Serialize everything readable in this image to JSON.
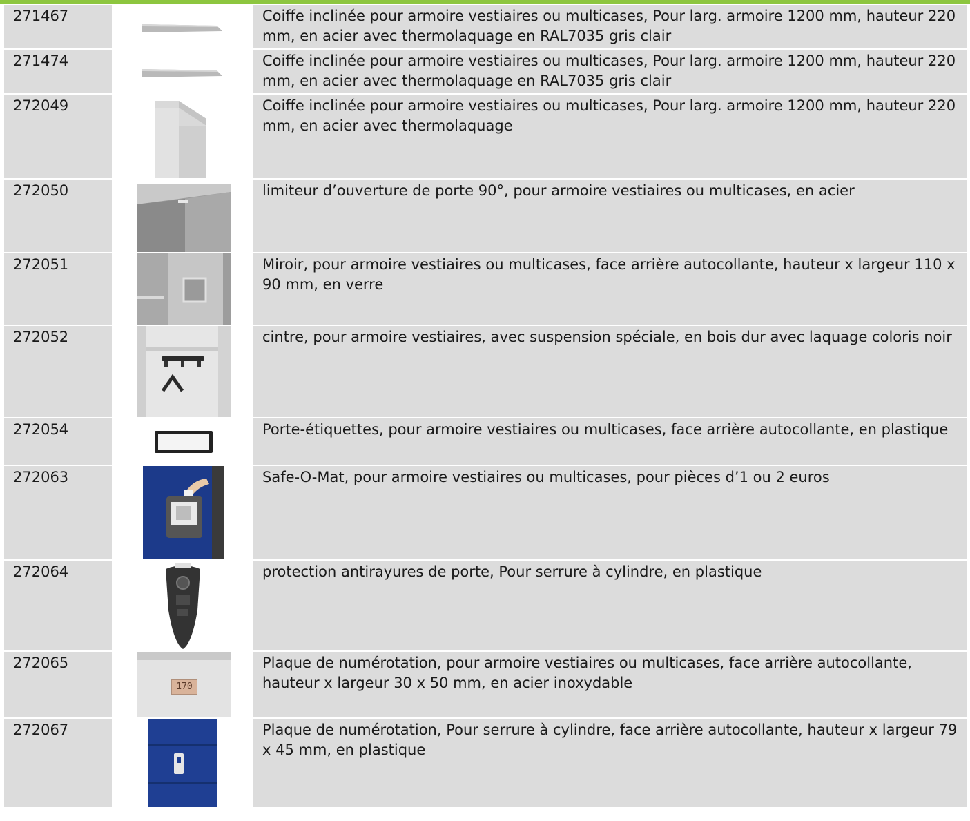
{
  "colors": {
    "accent_bar": "#8dc63f",
    "row_bg": "#dcdcdc"
  },
  "rows": [
    {
      "code": "271467",
      "image_icon": "sloped-cover-icon",
      "description": "Coiffe inclinée pour armoire vestiaires ou multicases, Pour larg. armoire 1200 mm, hauteur 220 mm, en acier avec thermolaquage en RAL7035 gris clair"
    },
    {
      "code": "271474",
      "image_icon": "sloped-cover-icon",
      "description": "Coiffe inclinée pour armoire vestiaires ou multicases, Pour larg. armoire 1200 mm, hauteur 220 mm, en acier avec thermolaquage en RAL7035 gris clair"
    },
    {
      "code": "272049",
      "image_icon": "locker-roof-icon",
      "description": "Coiffe inclinée pour armoire vestiaires ou multicases, Pour larg. armoire 1200 mm, hauteur 220 mm, en acier avec thermolaquage"
    },
    {
      "code": "272050",
      "image_icon": "door-limiter-icon",
      "description": "limiteur d’ouverture de porte 90°, pour armoire vestiaires ou multicases, en acier"
    },
    {
      "code": "272051",
      "image_icon": "mirror-icon",
      "description": "Miroir, pour armoire vestiaires ou multicases, face arrière autocollante, hauteur x largeur 110 x 90 mm, en verre"
    },
    {
      "code": "272052",
      "image_icon": "hanger-icon",
      "description": "cintre, pour armoire vestiaires, avec suspension spéciale, en bois dur avec laquage coloris noir"
    },
    {
      "code": "272054",
      "image_icon": "label-holder-icon",
      "description": "Porte-étiquettes, pour armoire vestiaires ou multicases, face arrière autocollante, en plastique"
    },
    {
      "code": "272063",
      "image_icon": "coin-lock-icon",
      "description": "Safe-O-Mat, pour armoire vestiaires ou multicases, pour pièces d’1 ou 2 euros"
    },
    {
      "code": "272064",
      "image_icon": "lock-guard-icon",
      "description": "protection antirayures de porte, Pour serrure à cylindre, en plastique"
    },
    {
      "code": "272065",
      "image_icon": "number-plate-icon",
      "image_text": "170",
      "description": "Plaque de numérotation, pour armoire vestiaires ou multicases, face arrière autocollante, hauteur x largeur 30 x 50 mm, en acier inoxydable"
    },
    {
      "code": "272067",
      "image_icon": "blue-locker-number-icon",
      "description": "Plaque de numérotation, Pour serrure à cylindre, face arrière autocollante, hauteur x largeur 79 x 45 mm, en plastique"
    }
  ]
}
